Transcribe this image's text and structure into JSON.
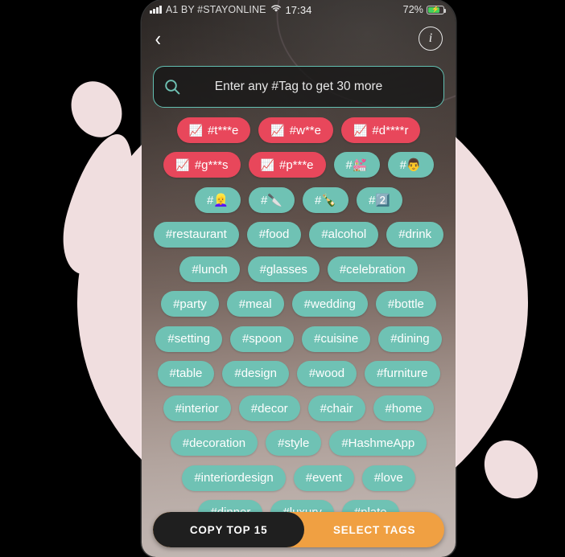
{
  "status_bar": {
    "signal_icon": "signal-bars-icon",
    "carrier": "A1 BY #STAYONLINE",
    "wifi_icon": "wifi-icon",
    "time": "17:34",
    "battery_percent": "72%",
    "battery_level": 72,
    "battery_charging": true
  },
  "nav": {
    "back_icon": "chevron-left-icon",
    "info_icon": "info-icon",
    "info_label": "i"
  },
  "search": {
    "icon": "search-icon",
    "placeholder": "Enter any #Tag to get 30 more",
    "value": ""
  },
  "colors": {
    "tag_teal": "#6FC2B4",
    "tag_hot_red": "#E8475B",
    "accent_orange": "#F0A042",
    "search_border_teal": "#63C0B2",
    "background_blob_pink": "#F0DEDF",
    "page_background": "#000000"
  },
  "tags": [
    {
      "label": "#t***e",
      "hot": true,
      "chart": "📈"
    },
    {
      "label": "#w**e",
      "hot": true,
      "chart": "📈"
    },
    {
      "label": "#d****r",
      "hot": true,
      "chart": "📈"
    },
    {
      "label": "#g***s",
      "hot": true,
      "chart": "📈"
    },
    {
      "label": "#p***e",
      "hot": true,
      "chart": "📈"
    },
    {
      "label": "#💒",
      "hot": false
    },
    {
      "label": "#👨",
      "hot": false
    },
    {
      "label": "#👱‍♀️",
      "hot": false
    },
    {
      "label": "#🔪",
      "hot": false
    },
    {
      "label": "#🍾",
      "hot": false
    },
    {
      "label": "#2️⃣",
      "hot": false
    },
    {
      "label": "#restaurant",
      "hot": false
    },
    {
      "label": "#food",
      "hot": false
    },
    {
      "label": "#alcohol",
      "hot": false
    },
    {
      "label": "#drink",
      "hot": false
    },
    {
      "label": "#lunch",
      "hot": false
    },
    {
      "label": "#glasses",
      "hot": false
    },
    {
      "label": "#celebration",
      "hot": false
    },
    {
      "label": "#party",
      "hot": false
    },
    {
      "label": "#meal",
      "hot": false
    },
    {
      "label": "#wedding",
      "hot": false
    },
    {
      "label": "#bottle",
      "hot": false
    },
    {
      "label": "#setting",
      "hot": false
    },
    {
      "label": "#spoon",
      "hot": false
    },
    {
      "label": "#cuisine",
      "hot": false
    },
    {
      "label": "#dining",
      "hot": false
    },
    {
      "label": "#table",
      "hot": false
    },
    {
      "label": "#design",
      "hot": false
    },
    {
      "label": "#wood",
      "hot": false
    },
    {
      "label": "#furniture",
      "hot": false
    },
    {
      "label": "#interior",
      "hot": false
    },
    {
      "label": "#decor",
      "hot": false
    },
    {
      "label": "#chair",
      "hot": false
    },
    {
      "label": "#home",
      "hot": false
    },
    {
      "label": "#decoration",
      "hot": false
    },
    {
      "label": "#style",
      "hot": false
    },
    {
      "label": "#HashmeApp",
      "hot": false
    },
    {
      "label": "#interiordesign",
      "hot": false
    },
    {
      "label": "#event",
      "hot": false
    },
    {
      "label": "#love",
      "hot": false
    },
    {
      "label": "#dinner",
      "hot": false
    },
    {
      "label": "#luxury",
      "hot": false
    },
    {
      "label": "#plate",
      "hot": false
    }
  ],
  "actions": {
    "copy_label": "COPY TOP 15",
    "select_label": "SELECT TAGS"
  }
}
